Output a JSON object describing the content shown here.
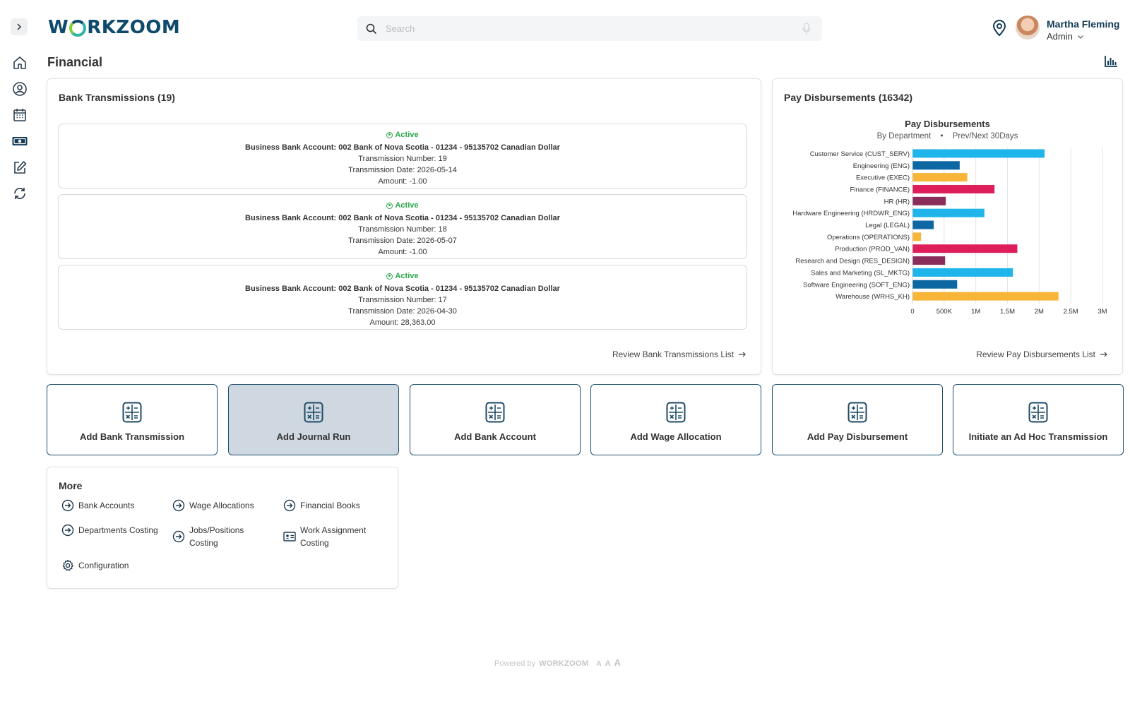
{
  "app": {
    "logo_text": "WORKZOOM",
    "logo_left": "W",
    "logo_right": "RKZOOM"
  },
  "header": {
    "search_placeholder": "Search",
    "user_name": "Martha Fleming",
    "user_role": "Admin"
  },
  "sidebar": {
    "icons": [
      "chevron-right-icon",
      "home-icon",
      "user-circle-icon",
      "calendar-icon",
      "money-icon",
      "edit-icon",
      "sync-icon"
    ]
  },
  "page": {
    "title": "Financial"
  },
  "bank": {
    "title": "Bank Transmissions (19)",
    "transmissions": [
      {
        "status": "Active",
        "account": "Business Bank Account: 002 Bank of Nova Scotia - 01234 - 95135702 Canadian Dollar",
        "number": "Transmission Number: 19",
        "date": "Transmission Date: 2026-05-14",
        "amount": "Amount: -1.00"
      },
      {
        "status": "Active",
        "account": "Business Bank Account: 002 Bank of Nova Scotia - 01234 - 95135702 Canadian Dollar",
        "number": "Transmission Number: 18",
        "date": "Transmission Date: 2026-05-07",
        "amount": "Amount: -1.00"
      },
      {
        "status": "Active",
        "account": "Business Bank Account: 002 Bank of Nova Scotia - 01234 - 95135702 Canadian Dollar",
        "number": "Transmission Number: 17",
        "date": "Transmission Date: 2026-04-30",
        "amount": "Amount: 28,363.00"
      }
    ],
    "review_link": "Review Bank Transmissions List"
  },
  "pay": {
    "title": "Pay Disbursements (16342)",
    "chart_title": "Pay Disbursements",
    "chart_sub_left": "By Department",
    "chart_sub_sep": "•",
    "chart_sub_right": "Prev/Next 30Days",
    "review_link": "Review Pay Disbursements List"
  },
  "chart_data": {
    "type": "bar",
    "orientation": "horizontal",
    "title": "Pay Disbursements",
    "subtitle": "By Department • Prev/Next 30Days",
    "categories": [
      "Customer Service (CUST_SERV)",
      "Engineering (ENG)",
      "Executive (EXEC)",
      "Finance (FINANCE)",
      "HR (HR)",
      "Hardware Engineering (HRDWR_ENG)",
      "Legal (LEGAL)",
      "Operations (OPERATIONS)",
      "Production (PROD_VAN)",
      "Research and Design (RES_DESIGN)",
      "Sales and Marketing (SL_MKTG)",
      "Software Engineering (SOFT_ENG)",
      "Warehouse (WRHS_KH)"
    ],
    "values": [
      2080000,
      740000,
      860000,
      1290000,
      520000,
      1130000,
      330000,
      130000,
      1650000,
      510000,
      1580000,
      700000,
      2300000
    ],
    "colors": [
      "#1fb5ea",
      "#0d67a3",
      "#f8b538",
      "#dd1e5b",
      "#8b2d5a",
      "#1fb5ea",
      "#0d67a3",
      "#f8b538",
      "#dd1e5b",
      "#8b2d5a",
      "#1fb5ea",
      "#0d67a3",
      "#f8b538"
    ],
    "xlim": [
      0,
      3000000
    ],
    "xticks": [
      0,
      500000,
      1000000,
      1500000,
      2000000,
      2500000,
      3000000
    ],
    "xtick_labels": [
      "0",
      "500K",
      "1M",
      "1.5M",
      "2M",
      "2.5M",
      "3M"
    ],
    "grid": "vertical"
  },
  "actions": [
    {
      "label": "Add Bank Transmission",
      "active": false
    },
    {
      "label": "Add Journal Run",
      "active": true
    },
    {
      "label": "Add Bank Account",
      "active": false
    },
    {
      "label": "Add Wage Allocation",
      "active": false
    },
    {
      "label": "Add Pay Disbursement",
      "active": false
    },
    {
      "label": "Initiate an Ad Hoc Transmission",
      "active": false
    }
  ],
  "more": {
    "title": "More",
    "items": [
      {
        "label": "Bank Accounts",
        "icon": "arrow-circle-right-icon"
      },
      {
        "label": "Wage Allocations",
        "icon": "arrow-circle-right-icon"
      },
      {
        "label": "Financial Books",
        "icon": "arrow-circle-right-icon"
      },
      {
        "label": "Departments Costing",
        "icon": "arrow-circle-right-icon"
      },
      {
        "label": "Jobs/Positions Costing",
        "icon": "arrow-circle-right-icon"
      },
      {
        "label": "Work Assignment Costing",
        "icon": "id-card-icon"
      },
      {
        "label": "Configuration",
        "icon": "gear-icon"
      }
    ]
  },
  "footer": {
    "powered_by": "Powered by",
    "brand": "WORKZOOM",
    "font_small": "A",
    "font_medium": "A",
    "font_large": "A"
  }
}
